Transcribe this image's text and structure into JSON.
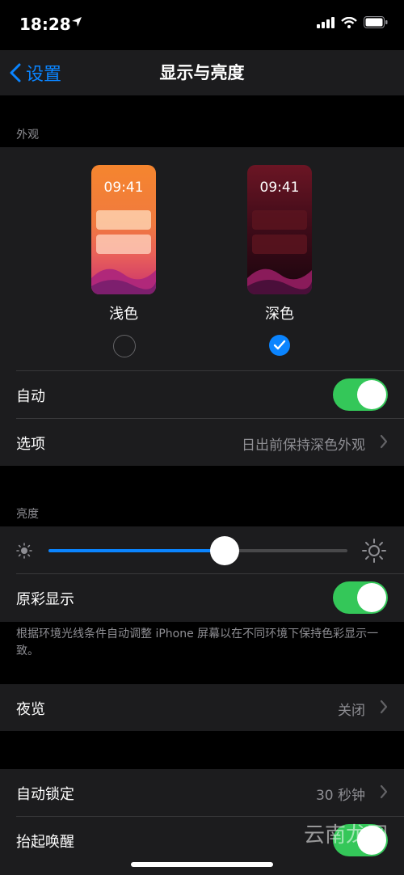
{
  "status": {
    "time": "18:28"
  },
  "nav": {
    "back_label": "设置",
    "title": "显示与亮度"
  },
  "appearance": {
    "header": "外观",
    "light": {
      "preview_time": "09:41",
      "label": "浅色",
      "selected": false
    },
    "dark": {
      "preview_time": "09:41",
      "label": "深色",
      "selected": true
    },
    "auto": {
      "label": "自动",
      "on": true
    },
    "options": {
      "label": "选项",
      "value": "日出前保持深色外观"
    }
  },
  "brightness": {
    "header": "亮度",
    "level": 0.59,
    "true_tone": {
      "label": "原彩显示",
      "on": true
    },
    "footnote": "根据环境光线条件自动调整 iPhone 屏幕以在不同环境下保持色彩显示一致。"
  },
  "night_shift": {
    "label": "夜览",
    "value": "关闭"
  },
  "lock": {
    "auto_lock": {
      "label": "自动锁定",
      "value": "30 秒钟"
    },
    "raise_to_wake": {
      "label": "抬起唤醒",
      "on": true
    }
  },
  "watermark": "云南龙网",
  "colors": {
    "accent": "#0a84ff",
    "toggle_on": "#34c759",
    "cell_bg": "#1c1c1e"
  }
}
